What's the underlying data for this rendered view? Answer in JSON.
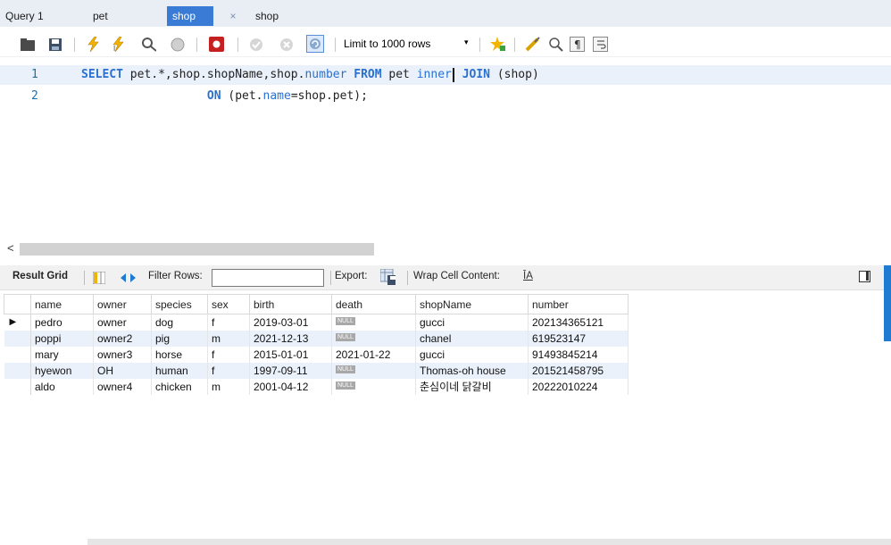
{
  "tabs": [
    {
      "label": "Query 1"
    },
    {
      "label": "pet"
    },
    {
      "label": "shop"
    },
    {
      "label": "shop"
    }
  ],
  "tab_close": "×",
  "toolbar": {
    "limit_label": "Limit to 1000 rows",
    "dropdown_arrow": "▾"
  },
  "editor": {
    "lines": [
      {
        "number": "1"
      },
      {
        "number": "2"
      }
    ]
  },
  "hscroll": {
    "left_arrow": "<"
  },
  "results": {
    "result_grid_label": "Result Grid",
    "filter_rows_label": "Filter Rows:",
    "filter_value": "",
    "export_label": "Export:",
    "wrap_label": "Wrap Cell Content:",
    "wrap_icon": "ĪA",
    "columns": [
      "name",
      "owner",
      "species",
      "sex",
      "birth",
      "death",
      "shopName",
      "number"
    ],
    "rows": [
      [
        "pedro",
        "owner",
        "dog",
        "f",
        "2019-03-01",
        "NULL",
        "gucci",
        "202134365121"
      ],
      [
        "poppi",
        "owner2",
        "pig",
        "m",
        "2021-12-13",
        "NULL",
        "chanel",
        "619523147"
      ],
      [
        "mary",
        "owner3",
        "horse",
        "f",
        "2015-01-01",
        "2021-01-22",
        "gucci",
        "91493845214"
      ],
      [
        "hyewon",
        "OH",
        "human",
        "f",
        "1997-09-11",
        "NULL",
        "Thomas-oh house",
        "201521458795"
      ],
      [
        "aldo",
        "owner4",
        "chicken",
        "m",
        "2001-04-12",
        "NULL",
        "춘심이네 닭갈비",
        "20222010224"
      ]
    ],
    "current_row_marker": "▶"
  },
  "colors": {
    "active_tab": "#3a7bd5",
    "keyword": "#2a70cf",
    "alt_row": "#eaf1fb"
  }
}
